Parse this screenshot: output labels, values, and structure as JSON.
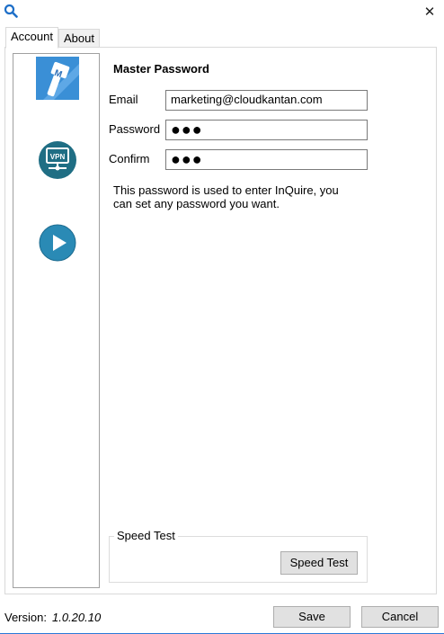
{
  "window": {
    "close_glyph": "✕"
  },
  "tabs": [
    {
      "label": "Account",
      "active": true
    },
    {
      "label": "About",
      "active": false
    }
  ],
  "sidebar": {
    "items": [
      {
        "icon": "master-password-icon"
      },
      {
        "icon": "vpn-icon",
        "icon_text": "VPN"
      },
      {
        "icon": "play-icon"
      }
    ]
  },
  "form": {
    "title": "Master Password",
    "email_label": "Email",
    "email_value": "marketing@cloudkantan.com",
    "password_label": "Password",
    "password_value": "●●●",
    "confirm_label": "Confirm",
    "confirm_value": "●●●",
    "note": "This password is used to enter InQuire, you can set any password you want."
  },
  "speed_test": {
    "group_label": "Speed Test",
    "button_label": "Speed Test"
  },
  "footer": {
    "version_label": "Version:",
    "version_value": "1.0.20.10",
    "save_label": "Save",
    "cancel_label": "Cancel"
  },
  "colors": {
    "accent": "#2b79d8",
    "icon_blue": "#3a8fd6",
    "icon_teal": "#1f6e84",
    "icon_play": "#2a8ab5"
  }
}
